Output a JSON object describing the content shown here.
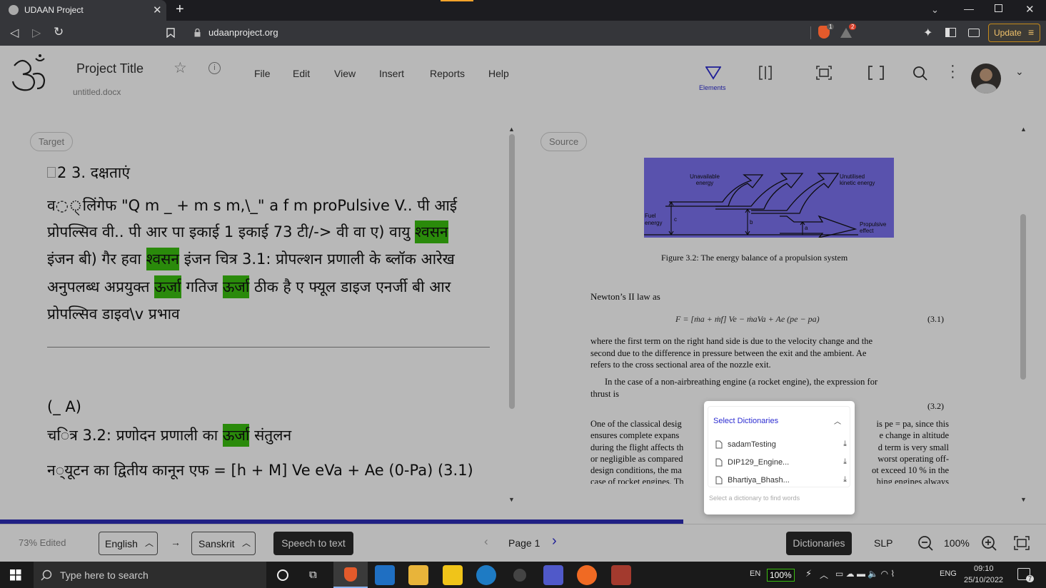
{
  "browser": {
    "tab_title": "UDAAN Project",
    "url": "udaanproject.org",
    "update_label": "Update",
    "brave_badge": "1",
    "alert_badge": "2"
  },
  "header": {
    "project_title": "Project Title",
    "filename": "untitled.docx",
    "menu": [
      "File",
      "Edit",
      "View",
      "Insert",
      "Reports",
      "Help"
    ],
    "elements_label": "Elements"
  },
  "target": {
    "label": "Target",
    "heading": "2 3. दक्षताएं",
    "lines": [
      {
        "segments": [
          {
            "t": "व◌্लिंगेफ \"Q m _ + m s m,\\_\" a f m proPulsive V.. पी आई",
            "h": false
          }
        ]
      },
      {
        "segments": [
          {
            "t": "प्रोपल्सिव वी.. पी आर पा इकाई 1 इकाई 73 टी/-> वी वा ए) वायु ",
            "h": false
          },
          {
            "t": "श्वसन",
            "h": true
          }
        ]
      },
      {
        "segments": [
          {
            "t": "इंजन बी) गैर हवा ",
            "h": false
          },
          {
            "t": "श्वसन",
            "h": true
          },
          {
            "t": " इंजन चित्र 3.1: प्रोपल्शन प्रणाली के ब्लॉक आरेख",
            "h": false
          }
        ]
      },
      {
        "segments": [
          {
            "t": "अनुपलब्ध अप्रयुक्त ",
            "h": false
          },
          {
            "t": "ऊर्जा",
            "h": true
          },
          {
            "t": " गतिज ",
            "h": false
          },
          {
            "t": "ऊर्जा",
            "h": true
          },
          {
            "t": " ठीक है ए फ्यूल डाइज एनर्जी बी आर",
            "h": false
          }
        ]
      },
      {
        "segments": [
          {
            "t": "प्रोपल्सिव डाइव\\v प्रभाव",
            "h": false
          }
        ]
      }
    ],
    "line_a": "(_ A)",
    "line_b_pre": "च◌ित्र 3.2: प्रणोदन प्रणाली का ",
    "line_b_hi": "ऊर्जा",
    "line_b_post": " संतुलन",
    "line_c": "न◌्यूटन का द्वितीय कानून एफ = [h + M] Ve eVa + Ae (0-Pa) (3.1)"
  },
  "source": {
    "label": "Source",
    "figure_labels": {
      "unavailable": "Unavailable energy",
      "unutilised": "Unutilised kinetic energy",
      "fuel": "Fuel energy",
      "propulsive": "Propulsive effect",
      "c": "c",
      "b": "b",
      "a": "a"
    },
    "caption": "Figure 3.2: The energy balance of a propulsion system",
    "newton": "Newton’s II law as",
    "equation": "F = [ṁa + ṁf] Ve − ṁaVa + Ae (pe − pa)",
    "eq_num": "(3.1)",
    "para1": [
      "where the first term on the right hand side is due to the velocity change and the",
      "second due to the difference in pressure between the exit and the ambient.  Ae",
      "refers to the cross sectional area of the nozzle exit."
    ],
    "para2": [
      "In the case of a non-airbreathing engine (a rocket engine), the expression for",
      "thrust is"
    ],
    "eq2_num": "(3.2)",
    "para3_left": [
      "One of the classical desig",
      "ensures complete expans",
      "during the flight affects th",
      "or negligible as compared",
      "design conditions, the ma",
      "case of rocket engines. Th"
    ],
    "para3_right": [
      "is pe = pa, since this",
      "e change in altitude",
      "d term is very small",
      "worst operating off-",
      "ot exceed 10 % in the",
      "hing engines always"
    ]
  },
  "dictionaries": {
    "title": "Select Dictionaries",
    "items": [
      "sadamTesting",
      "DIP129_Engine...",
      "Bhartiya_Bhash..."
    ],
    "hint": "Select a dictionary to find words"
  },
  "bottom": {
    "edited": "73% Edited",
    "progress": 0.653,
    "source_lang": "English",
    "arrow": "→",
    "target_lang": "Sanskrit",
    "speech": "Speech to text",
    "page": "Page 1",
    "dictionaries": "Dictionaries",
    "slp": "SLP",
    "zoom": "100%"
  },
  "taskbar": {
    "search": "Type here to search",
    "lang1": "EN",
    "battery": "100%",
    "lang2": "ENG",
    "time": "09:10",
    "date": "25/10/2022",
    "notif": "7"
  },
  "colors": {
    "highlight": "#3bbf10",
    "progress": "#2f2fb8",
    "figure_bg": "#7c72f0",
    "accent": "#2b2bd1"
  }
}
